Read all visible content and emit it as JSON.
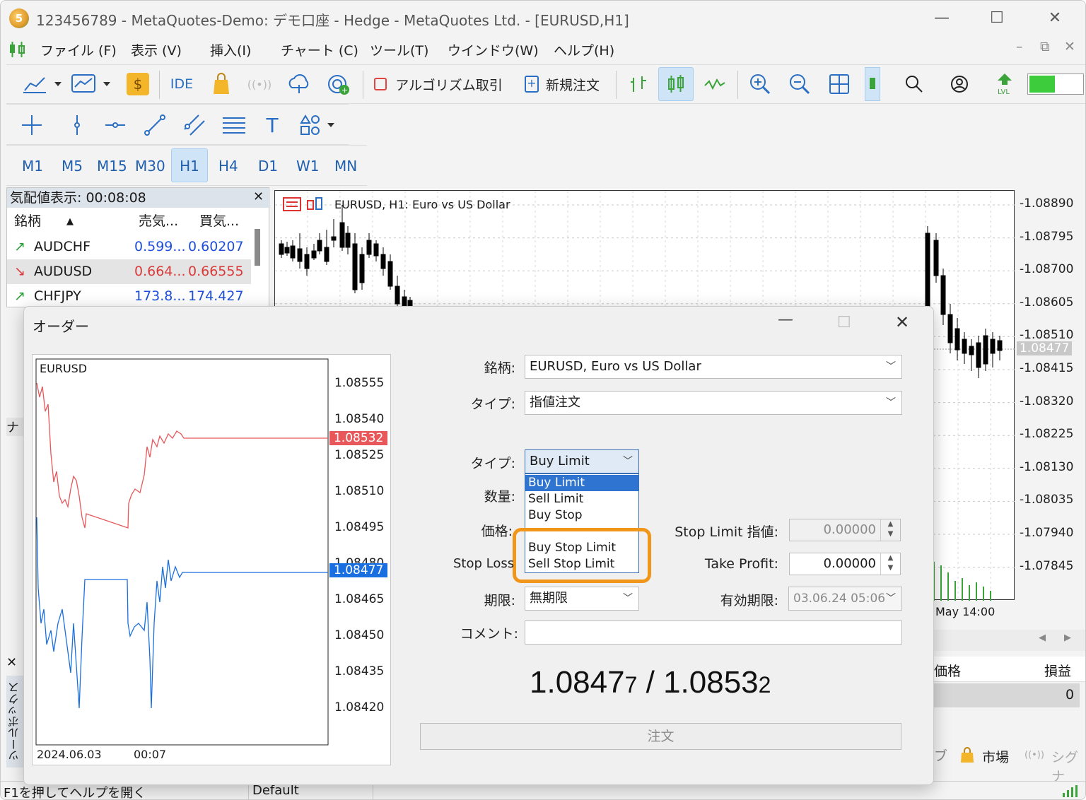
{
  "window": {
    "title": "123456789 - MetaQuotes-Demo: デモ口座 - Hedge - MetaQuotes Ltd. - [EURUSD,H1]",
    "app_icon_text": "5"
  },
  "menu": [
    "ファイル (F)",
    "表示 (V)",
    "挿入(I)",
    "チャート (C)",
    "ツール(T)",
    "ウインドウ(W)",
    "ヘルプ(H)"
  ],
  "toolbar": {
    "ide_label": "IDE",
    "algo_label": "アルゴリズム取引",
    "new_order_label": "新規注文"
  },
  "timeframes": [
    "M1",
    "M5",
    "M15",
    "M30",
    "H1",
    "H4",
    "D1",
    "W1",
    "MN"
  ],
  "active_timeframe": "H1",
  "market_watch": {
    "title": "気配値表示: 00:08:08",
    "headers": [
      "銘柄",
      "売気...",
      "買気..."
    ],
    "rows": [
      {
        "dir": "up",
        "symbol": "AUDCHF",
        "bid": "0.599...",
        "ask": "0.60207"
      },
      {
        "dir": "down",
        "symbol": "AUDUSD",
        "bid": "0.664...",
        "ask": "0.66555"
      },
      {
        "dir": "up",
        "symbol": "CHFJPY",
        "bid": "173.8...",
        "ask": "174.427"
      }
    ]
  },
  "chart": {
    "caption": "EURUSD, H1:  Euro vs US Dollar",
    "price_labels": [
      "1.08890",
      "1.08795",
      "1.08700",
      "1.08605",
      "1.08510",
      "1.08415",
      "1.08320",
      "1.08225",
      "1.08130",
      "1.08035",
      "1.07940",
      "1.07845"
    ],
    "current_price": "1.08477",
    "time_label": "May 14:00"
  },
  "side_panels": {
    "navigator_letter": "ナ",
    "toolbox_label": "ツールボックス",
    "col_price": "価格",
    "col_profit": "損益",
    "profit_value": "0",
    "tab_market": "市場",
    "tab_signal": "シグナ",
    "tab_partial": "ブ"
  },
  "dialog": {
    "title": "オーダー",
    "symbol_label": "銘柄:",
    "symbol_value": "EURUSD, Euro vs US Dollar",
    "type_label": "タイプ:",
    "type_value": "指値注文",
    "order_type_label": "タイプ:",
    "order_type_value": "Buy Limit",
    "volume_label": "数量:",
    "price_label": "価格:",
    "stop_limit_label": "Stop Limit 指値:",
    "stop_limit_value": "0.00000",
    "stop_loss_label": "Stop Loss",
    "take_profit_label": "Take Profit:",
    "take_profit_value": "0.00000",
    "expiry_label": "期限:",
    "expiry_value": "無期限",
    "expiry_date_label": "有効期限:",
    "expiry_date_value": "03.06.24 05:06",
    "comment_label": "コメント:",
    "bid_price": "1.08477",
    "ask_price": "1.08532",
    "bid_main": "1.0847",
    "bid_small": "7",
    "ask_main": "1.0853",
    "ask_small": "2",
    "separator": "/",
    "submit_label": "注文",
    "dropdown_options": [
      "Buy Limit",
      "Sell Limit",
      "Buy Stop",
      "Buy Stop Limit",
      "Sell Stop Limit"
    ],
    "dropdown_selected": "Buy Limit",
    "highlight_color": "#f0961a"
  },
  "tick_chart": {
    "symbol": "EURUSD",
    "y_labels": [
      "1.08555",
      "1.08540",
      "1.08525",
      "1.08510",
      "1.08495",
      "1.08480",
      "1.08465",
      "1.08450",
      "1.08435",
      "1.08420"
    ],
    "ask_tag": "1.08532",
    "bid_tag": "1.08477",
    "x_labels": [
      "2024.06.03",
      "00:07"
    ],
    "ask_color": "#e8575a",
    "bid_color": "#1a6fe0"
  },
  "status": {
    "help_text": "F1を押してヘルプを開く",
    "profile": "Default"
  }
}
